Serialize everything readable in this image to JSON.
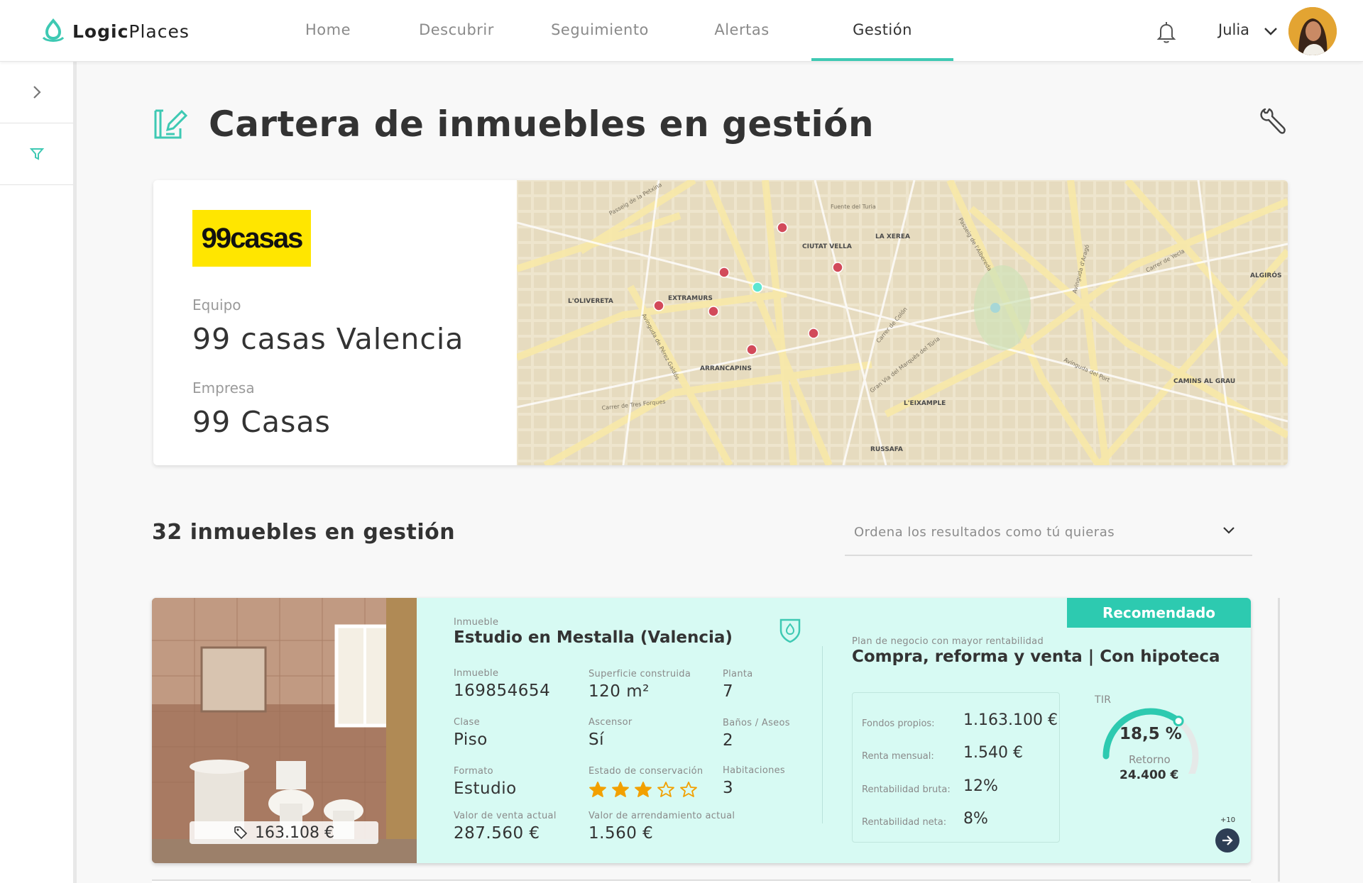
{
  "app": {
    "logo_bold": "Logic",
    "logo_light": "Places",
    "colors": {
      "accent": "#3ec9b3",
      "badge": "#2dcab0",
      "card_bg": "#d7faf3",
      "map_pin": "#d24a5a",
      "map_pin_active": "#5ee6d2"
    }
  },
  "nav": {
    "items": [
      {
        "label": "Home"
      },
      {
        "label": "Descubrir"
      },
      {
        "label": "Seguimiento"
      },
      {
        "label": "Alertas"
      },
      {
        "label": "Gestión"
      }
    ],
    "active": "Gestión",
    "user_name": "Julia"
  },
  "sidebar": {
    "icons": [
      "chevron-right-icon",
      "filter-icon"
    ]
  },
  "page": {
    "title": "Cartera de inmuebles en gestión"
  },
  "team": {
    "brand": "99casas",
    "team_label": "Equipo",
    "team_value": "99 casas Valencia",
    "company_label": "Empresa",
    "company_value": "99 Casas"
  },
  "map": {
    "labels": [
      "CIUTAT VELLA",
      "LA XEREA",
      "EXTRAMURS",
      "L'OLIVERETA",
      "ARRANCAPINS",
      "L'EIXAMPLE",
      "RUSSAFA",
      "ALGIRÓS",
      "CAMINS AL GRAU",
      "Fuente del Turia",
      "Passeig de la Petxina",
      "Passeig de l'Albereda",
      "Avinguda de Pérez Galdós",
      "Gran Via del Marquès del Túria",
      "Carrer de Tres Forques",
      "Avinguda del Port",
      "Carrer de Colón",
      "Avinguda d'Aragó",
      "Carrer de Yecla"
    ]
  },
  "results": {
    "count_text": "32 inmuebles en gestión",
    "sort_placeholder": "Ordena los resultados como tú quieras"
  },
  "property": {
    "price_tag": "163.108 €",
    "type_label": "Inmueble",
    "title": "Estudio en Mestalla (Valencia)",
    "fields": {
      "ref_label": "Inmueble",
      "ref": "169854654",
      "surface_label": "Superficie construida",
      "surface": "120 m²",
      "floor_label": "Planta",
      "floor": "7",
      "class_label": "Clase",
      "class": "Piso",
      "elevator_label": "Ascensor",
      "elevator": "Sí",
      "baths_label": "Baños / Aseos",
      "baths": "2",
      "format_label": "Formato",
      "format": "Estudio",
      "condition_label": "Estado de conservación",
      "rooms_label": "Habitaciones",
      "rooms": "3",
      "sale_label": "Valor de venta actual",
      "sale": "287.560 €",
      "rent_label": "Valor de arrendamiento actual",
      "rent": "1.560 €"
    },
    "condition_stars": 3,
    "condition_max": 5,
    "badge": "Recomendado",
    "plan_label": "Plan de negocio con mayor rentabilidad",
    "plan_title": "Compra, reforma y venta | Con hipoteca",
    "finance": {
      "own_funds_label": "Fondos propios:",
      "own_funds": "1.163.100 €",
      "monthly_label": "Renta mensual:",
      "monthly": "1.540 €",
      "gross_label": "Rentabilidad bruta:",
      "gross": "12%",
      "net_label": "Rentabilidad neta:",
      "net": "8%"
    },
    "tir_label": "TIR",
    "tir_value": "18,5 %",
    "tir_fraction": 0.62,
    "return_label": "Retorno",
    "return_value": "24.400 €",
    "more_count": "+10"
  }
}
